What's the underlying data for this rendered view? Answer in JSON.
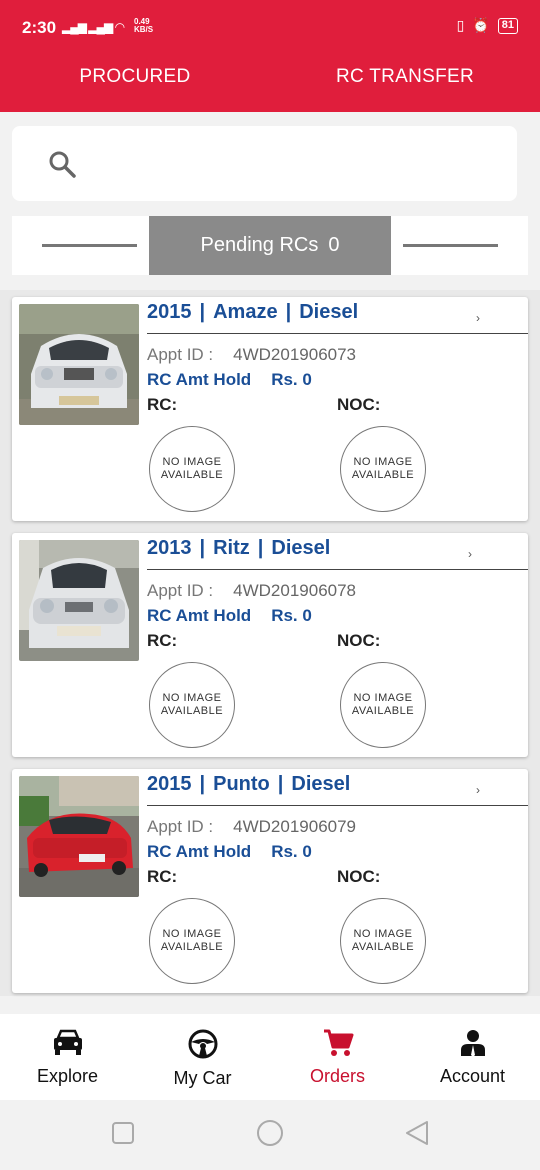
{
  "status_bar": {
    "time": "2:30",
    "net_speed_value": "0.49",
    "net_speed_unit": "KB/S",
    "battery": "81"
  },
  "tabs": [
    {
      "label": "PROCURED"
    },
    {
      "label": "RC TRANSFER"
    }
  ],
  "pending": {
    "label": "Pending RCs",
    "count": "0"
  },
  "cards": [
    {
      "year": "2015",
      "model": "Amaze",
      "fuel": "Diesel",
      "appt_label": "Appt ID :",
      "appt_id": "4WD201906073",
      "amt_label": "RC Amt Hold",
      "amt_value": "Rs. 0",
      "rc_label": "RC:",
      "noc_label": "NOC:",
      "no_image_1": "NO IMAGE",
      "no_image_2": "AVAILABLE"
    },
    {
      "year": "2013",
      "model": "Ritz",
      "fuel": "Diesel",
      "appt_label": "Appt ID :",
      "appt_id": "4WD201906078",
      "amt_label": "RC Amt Hold",
      "amt_value": "Rs. 0",
      "rc_label": "RC:",
      "noc_label": "NOC:",
      "no_image_1": "NO IMAGE",
      "no_image_2": "AVAILABLE"
    },
    {
      "year": "2015",
      "model": "Punto",
      "fuel": "Diesel",
      "appt_label": "Appt ID :",
      "appt_id": "4WD201906079",
      "amt_label": "RC Amt Hold",
      "amt_value": "Rs. 0",
      "rc_label": "RC:",
      "noc_label": "NOC:",
      "no_image_1": "NO IMAGE",
      "no_image_2": "AVAILABLE"
    }
  ],
  "bottom_nav": [
    {
      "label": "Explore",
      "icon": "car-icon"
    },
    {
      "label": "My Car",
      "icon": "steering-wheel-icon"
    },
    {
      "label": "Orders",
      "icon": "cart-icon",
      "active": true
    },
    {
      "label": "Account",
      "icon": "account-icon"
    }
  ],
  "colors": {
    "brand_red": "#e01e3c",
    "link_blue": "#1a4e96",
    "active_nav": "#c8102e",
    "pending_bg": "#8a8a8a"
  }
}
